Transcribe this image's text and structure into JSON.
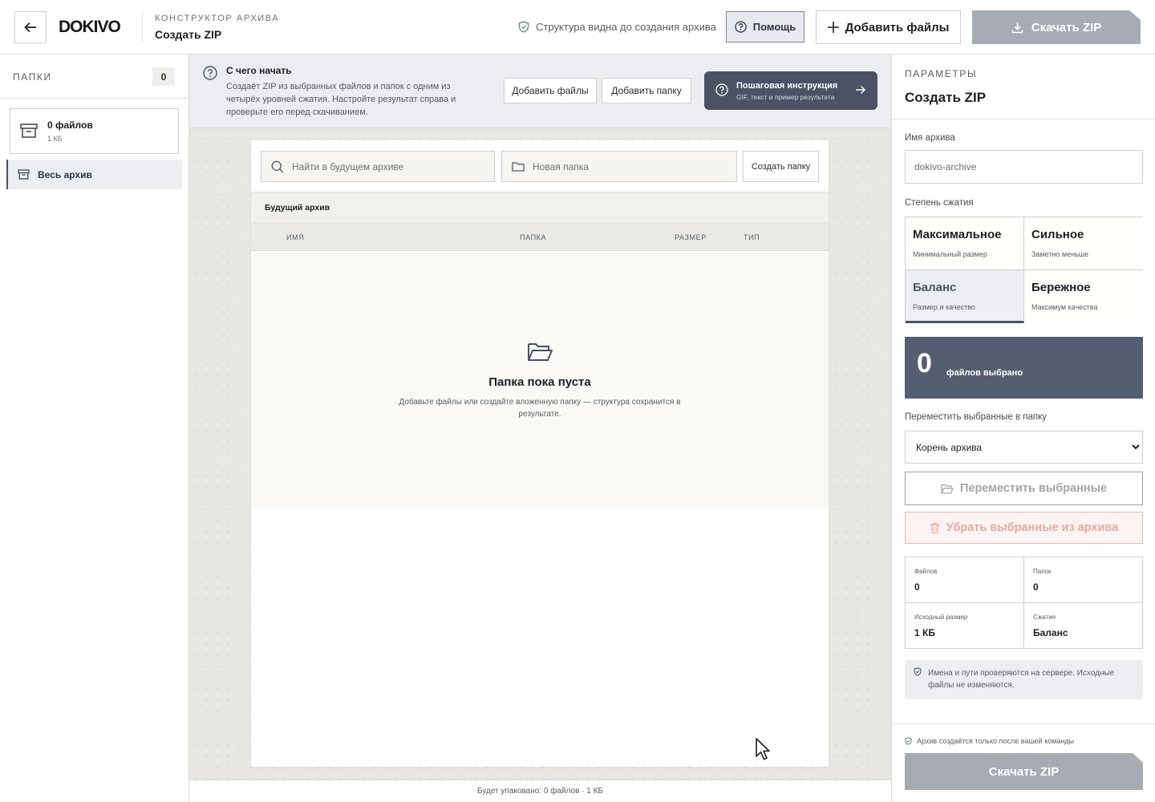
{
  "header": {
    "logo": "DOKIVO",
    "kicker": "КОНСТРУКТОР АРХИВА",
    "title": "Создать ZIP",
    "structure_note": "Структура видна до создания архива",
    "help_label": "Помощь",
    "add_files_label": "Добавить файлы",
    "download_label": "Скачать ZIP"
  },
  "sidebar": {
    "title": "ПАПКИ",
    "count": "0",
    "file_card": {
      "title": "0 файлов",
      "size": "1 КБ"
    },
    "tree_root": "Весь архив"
  },
  "intro": {
    "heading": "С чего начать",
    "text": "Создаёт ZIP из выбранных файлов и папок с одним из четырёх уровней сжатия. Настройте результат справа и проверьте его перед скачиванием.",
    "add_files": "Добавить файлы",
    "add_folder": "Добавить папку",
    "guide_title": "Пошаговая инструкция",
    "guide_sub": "GIF, текст и пример результата"
  },
  "workspace": {
    "search_placeholder": "Найти в будущем архиве",
    "new_folder_placeholder": "Новая папка",
    "create_folder": "Создать папку",
    "section_title": "Будущий архив",
    "columns": [
      "ИМЯ",
      "ПАПКА",
      "РАЗМЕР",
      "ТИП"
    ],
    "empty_title": "Папка пока пуста",
    "empty_desc": "Добавьте файлы или создайте вложенную папку — структура сохранится в результате.",
    "footer": "Будет упаковано: 0 файлов · 1 КБ"
  },
  "panel": {
    "kicker": "ПАРАМЕТРЫ",
    "title": "Создать ZIP",
    "name_label": "Имя архива",
    "name_value": "dokivo-archive",
    "compression_label": "Степень сжатия",
    "options": [
      {
        "title": "Максимальное",
        "sub": "Минимальный размер"
      },
      {
        "title": "Сильное",
        "sub": "Заметно меньше"
      },
      {
        "title": "Баланс",
        "sub": "Размер и качество"
      },
      {
        "title": "Бережное",
        "sub": "Максимум качества"
      }
    ],
    "selected_option": "Баланс",
    "selected_count": "0",
    "selected_text": "файлов выбрано",
    "move_label": "Переместить выбранные в папку",
    "move_select_value": "Корень архива",
    "move_button": "Переместить выбранные",
    "remove_button": "Убрать выбранные из архива",
    "stats": [
      {
        "key": "Файлов",
        "value": "0"
      },
      {
        "key": "Папок",
        "value": "0"
      },
      {
        "key": "Исходный размер",
        "value": "1 КБ"
      },
      {
        "key": "Сжатие",
        "value": "Баланс"
      }
    ],
    "note": "Имена и пути проверяются на сервере. Исходные файлы не изменяются.",
    "footer_note": "Архив создаётся только после вашей команды",
    "download_label": "Скачать ZIP"
  },
  "colors": {
    "accent": "#4a5263",
    "disabled": "#a6abb4",
    "danger_soft": "#e2aaa4"
  }
}
